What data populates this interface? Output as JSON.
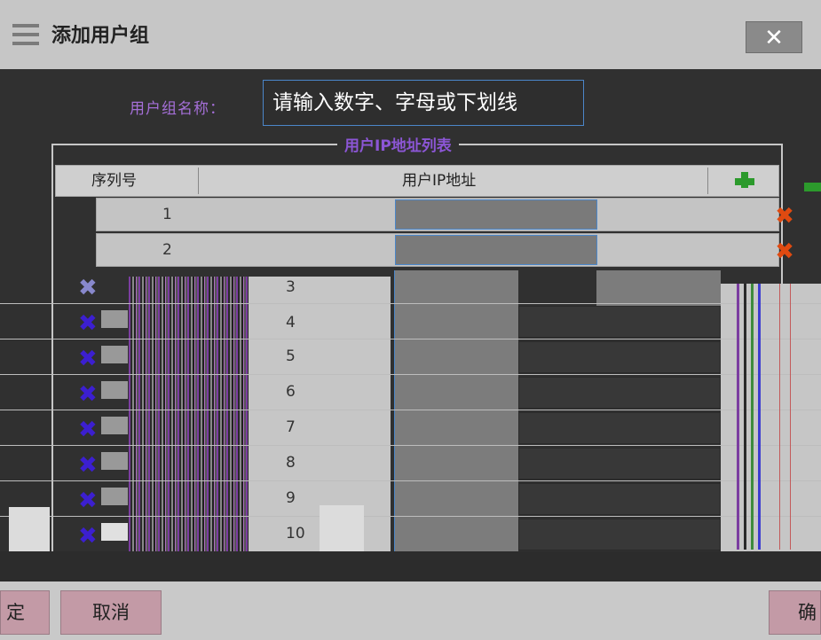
{
  "dialog": {
    "title": "添加用户组",
    "close_icon": "close-icon",
    "menu_icon": "hamburger-menu-icon"
  },
  "form": {
    "name_label": "用户组名称：",
    "name_placeholder": "请输入数字、字母或下划线"
  },
  "ip_list": {
    "legend": "用户IP地址列表",
    "columns": [
      "序列号",
      "用户IP地址"
    ],
    "add_icon": "add-plus-icon",
    "delete_icon": "delete-x-icon",
    "rows": [
      "1",
      "2",
      "3",
      "4",
      "5",
      "6",
      "7",
      "8",
      "9",
      "10"
    ]
  },
  "footer": {
    "confirm_left": "定",
    "cancel": "取消",
    "confirm_right": "确"
  },
  "colors": {
    "delete": "#e04a10",
    "add": "#2c9a2c",
    "button": "#c39aa6",
    "input_border": "#4b86c9"
  }
}
